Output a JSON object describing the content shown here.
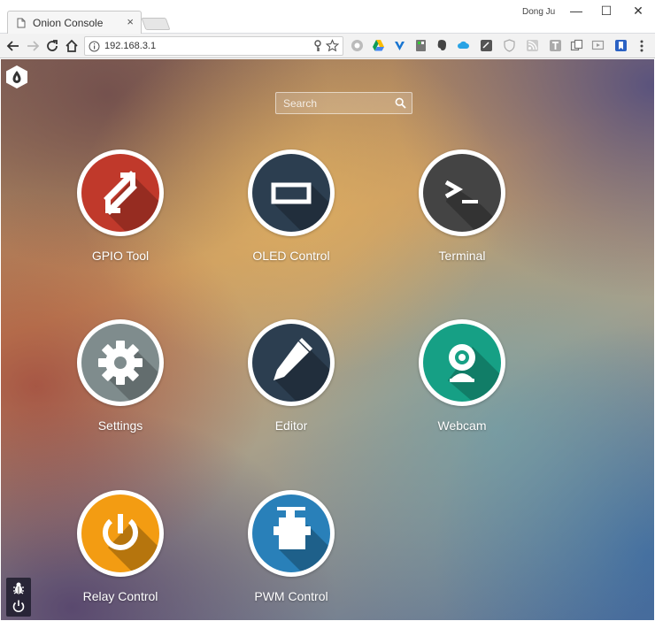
{
  "browser": {
    "tab_title": "Onion Console",
    "tab_close": "×",
    "user_name": "Dong Ju",
    "window": {
      "minimize": "—",
      "maximize": "☐",
      "close": "✕"
    },
    "address": "192.168.3.1"
  },
  "page": {
    "search": {
      "placeholder": "Search"
    },
    "apps": [
      {
        "label": "GPIO Tool",
        "color": "#c0392b",
        "icon": "arrows-exchange-icon"
      },
      {
        "label": "OLED Control",
        "color": "#2c3e50",
        "icon": "rectangle-display-icon"
      },
      {
        "label": "Terminal",
        "color": "#444444",
        "icon": "terminal-prompt-icon"
      },
      {
        "label": "Settings",
        "color": "#7f8c8d",
        "icon": "gear-icon"
      },
      {
        "label": "Editor",
        "color": "#2c3e50",
        "icon": "pencil-icon"
      },
      {
        "label": "Webcam",
        "color": "#16a085",
        "icon": "webcam-icon"
      },
      {
        "label": "Relay Control",
        "color": "#f39c12",
        "icon": "power-icon"
      },
      {
        "label": "PWM Control",
        "color": "#2980b9",
        "icon": "servo-motor-icon"
      }
    ]
  }
}
